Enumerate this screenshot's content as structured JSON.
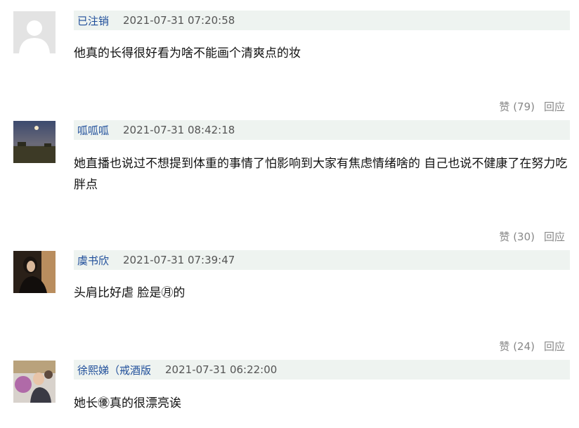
{
  "comments": [
    {
      "user": "已注销",
      "time": "2021-07-31 07:20:58",
      "text": "他真的长得很好看为啥不能画个清爽点的妆",
      "like_label": "赞 (79)",
      "reply_label": "回应"
    },
    {
      "user": "呱呱呱",
      "time": "2021-07-31 08:42:18",
      "text": "她直播也说过不想提到体重的事情了怕影响到大家有焦虑情绪啥的 自己也说不健康了在努力吃胖点",
      "like_label": "赞 (30)",
      "reply_label": "回应"
    },
    {
      "user": "虞书欣",
      "time": "2021-07-31 07:39:47",
      "text": "头肩比好虐 脸是㊊的",
      "like_label": "赞 (24)",
      "reply_label": "回应"
    },
    {
      "user": "徐熙娣（戒酒版",
      "time": "2021-07-31 06:22:00",
      "text": "她长㊝真的很漂亮诶"
    }
  ]
}
